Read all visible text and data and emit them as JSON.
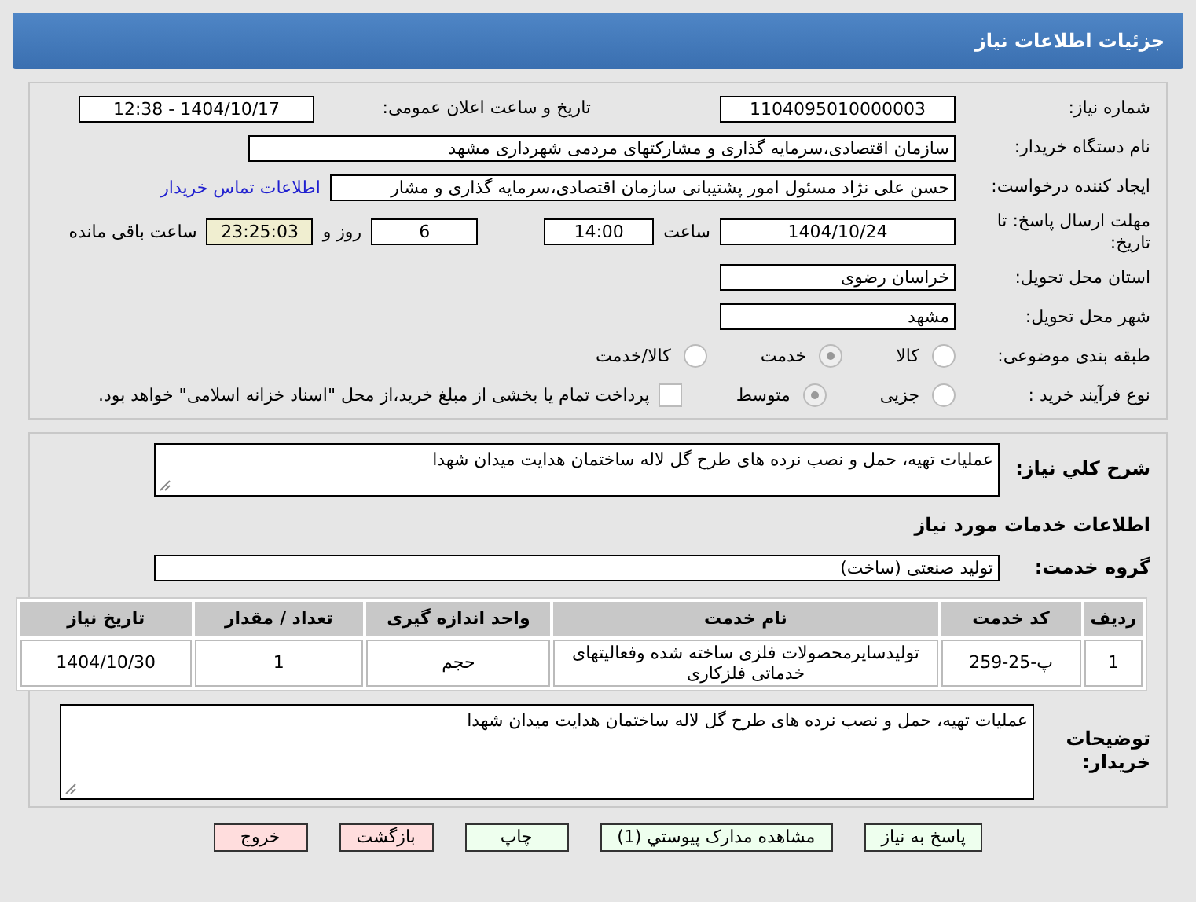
{
  "header": {
    "title": "جزئیات اطلاعات نیاز"
  },
  "fields": {
    "need_number": {
      "label": "شماره نیاز:",
      "value": "1104095010000003"
    },
    "announce": {
      "label": "تاریخ و ساعت اعلان عمومی:",
      "value": "1404/10/17 - 12:38"
    },
    "buyer_org": {
      "label": "نام دستگاه خریدار:",
      "value": "سازمان اقتصادی،سرمایه گذاری و مشارکتهای مردمی شهرداری مشهد"
    },
    "creator": {
      "label": "ایجاد کننده درخواست:",
      "value": "حسن علی نژاد مسئول امور پشتیبانی سازمان اقتصادی،سرمایه گذاری و مشار",
      "link": "اطلاعات تماس خریدار"
    },
    "deadline": {
      "label": "مهلت ارسال پاسخ: تا تاریخ:",
      "date": "1404/10/24",
      "time_label": "ساعت",
      "time": "14:00",
      "days": "6",
      "days_label": "روز و",
      "remaining": "23:25:03",
      "remaining_label": "ساعت باقی مانده"
    },
    "province": {
      "label": "استان محل تحویل:",
      "value": "خراسان رضوی"
    },
    "city": {
      "label": "شهر محل تحویل:",
      "value": "مشهد"
    }
  },
  "category": {
    "label": "طبقه بندی موضوعی:",
    "options": [
      {
        "label": "كالا",
        "selected": false,
        "disabled": false
      },
      {
        "label": "خدمت",
        "selected": true,
        "disabled": true
      },
      {
        "label": "كالا/خدمت",
        "selected": false,
        "disabled": false
      }
    ]
  },
  "purchase": {
    "label": "نوع فرآیند خرید :",
    "options": [
      {
        "label": "جزیی",
        "selected": false,
        "disabled": false
      },
      {
        "label": "متوسط",
        "selected": true,
        "disabled": true
      }
    ],
    "payment": {
      "checked": false,
      "text": "پرداخت تمام یا بخشی از مبلغ خرید،از محل \"اسناد خزانه اسلامی\" خواهد بود."
    }
  },
  "summary": {
    "label": "شرح کلي نياز:",
    "value": "عملیات تهیه، حمل و نصب نرده های طرح گل لاله ساختمان هدایت میدان شهدا"
  },
  "services_title": "اطلاعات خدمات مورد نياز",
  "service_group": {
    "label": "گروه خدمت:",
    "value": "تولید صنعتی (ساخت)"
  },
  "table": {
    "columns": [
      "رديف",
      "کد خدمت",
      "نام خدمت",
      "واحد اندازه گیری",
      "تعداد / مقدار",
      "تاریخ نیاز"
    ],
    "rows": [
      [
        "1",
        "پ-25-259",
        "تولیدسایرمحصولات فلزی ساخته شده وفعالیتهای خدماتی فلزکاری",
        "حجم",
        "1",
        "1404/10/30"
      ]
    ]
  },
  "buyer_notes": {
    "label": "توضیحات خریدار:",
    "value": "عملیات تهیه، حمل و نصب نرده های طرح گل لاله ساختمان هدایت میدان شهدا"
  },
  "buttons": [
    {
      "label": "پاسخ به نیاز",
      "kind": "green"
    },
    {
      "label": "مشاهده مدارک پیوستي (1)",
      "kind": "green"
    },
    {
      "label": "چاپ",
      "kind": "green"
    },
    {
      "label": "بازگشت",
      "kind": "red"
    },
    {
      "label": "خروج",
      "kind": "red"
    }
  ]
}
